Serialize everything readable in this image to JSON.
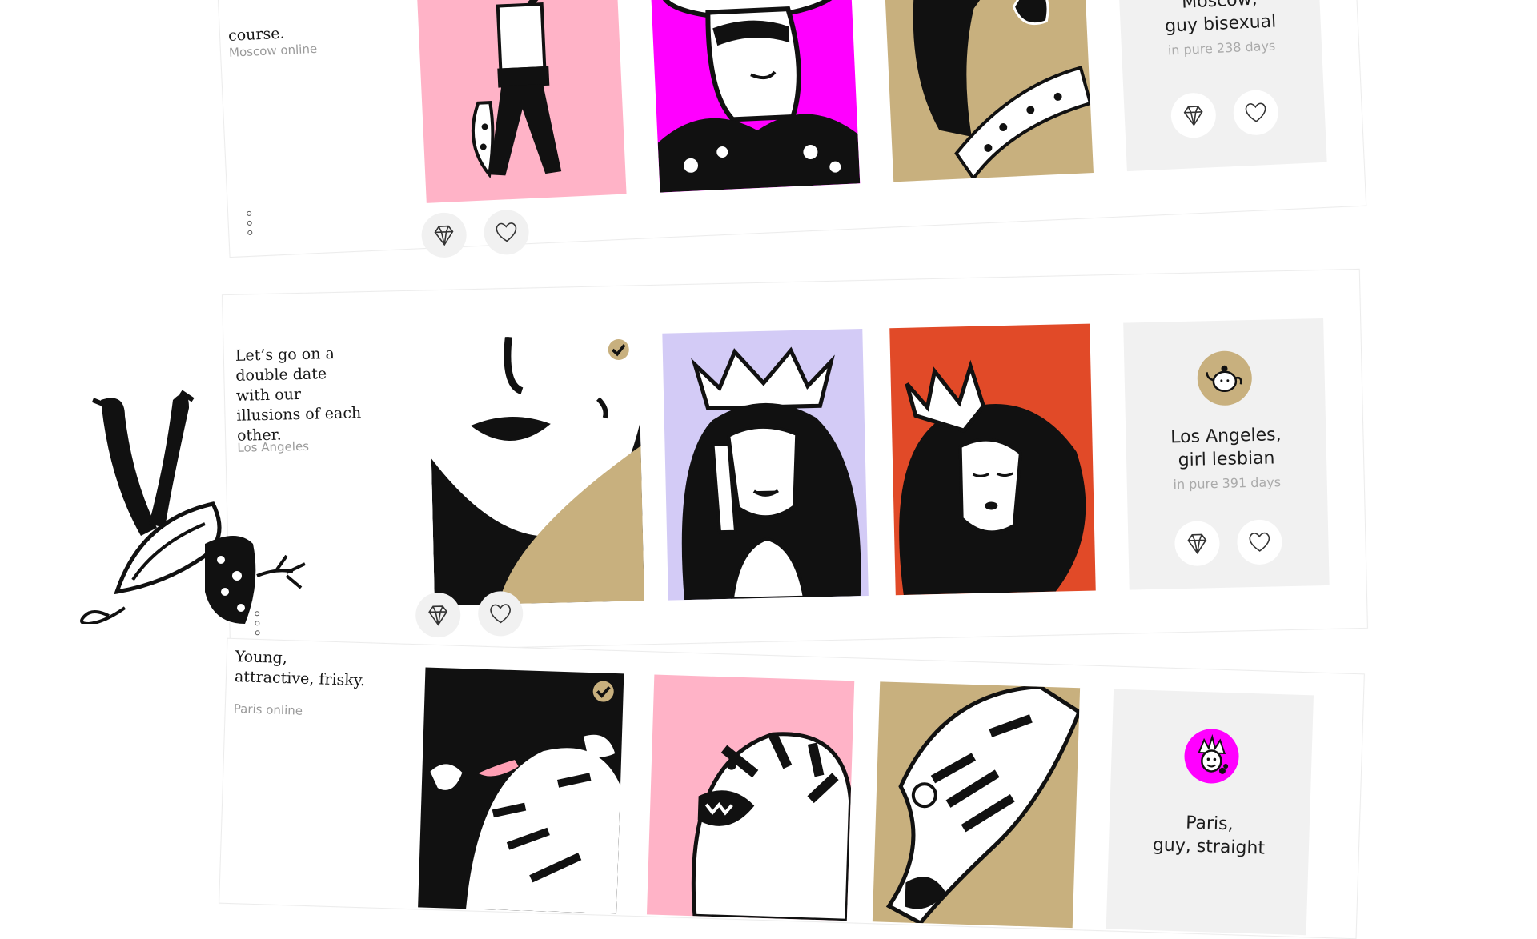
{
  "colors": {
    "pink": "#ffb3c7",
    "magenta": "#ff00ff",
    "tan": "#c8b07e",
    "lavender": "#d3cbf6",
    "orange_red": "#e14a28",
    "panel_grey": "#f1f1f1",
    "black": "#111111"
  },
  "profiles": [
    {
      "intro": "course.",
      "city": "Moscow online",
      "panel_location_line1": "Moscow,",
      "panel_location_line2": "guy bisexual",
      "panel_days": "in pure 238 days",
      "photo_colors": [
        "pink",
        "magenta",
        "tan"
      ],
      "icons": [
        "diamond-icon",
        "heart-icon",
        "more-dots-icon"
      ]
    },
    {
      "intro": "Let’s go on a double date with our illusions of each other.",
      "city": "Los Angeles",
      "panel_location_line1": "Los Angeles,",
      "panel_location_line2": "girl lesbian",
      "panel_days": "in pure 391 days",
      "photo_colors": [
        "tan",
        "lavender",
        "orange_red"
      ],
      "avatar_icon": "teapot-avatar-icon",
      "verified_icon": "check-icon",
      "icons": [
        "diamond-icon",
        "heart-icon",
        "more-dots-icon"
      ]
    },
    {
      "intro": "Young, attractive, frisky.",
      "city": "Paris online",
      "panel_location_line1": "Paris,",
      "panel_location_line2": "guy, straight",
      "photo_colors": [
        "black",
        "pink",
        "tan"
      ],
      "avatar_icon": "jester-avatar-icon",
      "verified_icon": "check-icon"
    }
  ]
}
